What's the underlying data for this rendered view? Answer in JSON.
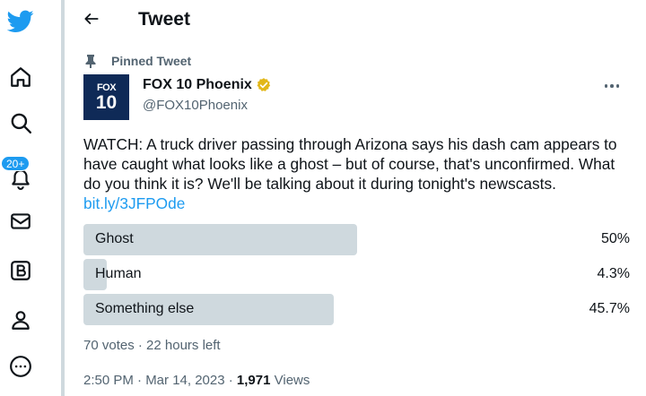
{
  "sidebar": {
    "items": [
      {
        "icon": "twitter-logo-icon"
      },
      {
        "icon": "home-icon"
      },
      {
        "icon": "search-icon"
      },
      {
        "icon": "notifications-icon"
      },
      {
        "icon": "messages-icon"
      },
      {
        "icon": "bookmarks-icon"
      },
      {
        "icon": "profile-icon"
      },
      {
        "icon": "more-icon"
      }
    ],
    "notification_count": "20+"
  },
  "header": {
    "title": "Tweet"
  },
  "tweet": {
    "pinned_label": "Pinned Tweet",
    "avatar": {
      "line1": "FOX",
      "line2": "10"
    },
    "display_name": "FOX 10 Phoenix",
    "handle": "@FOX10Phoenix",
    "text": "WATCH: A truck driver passing through Arizona says his dash cam appears to have caught what looks like a ghost – but of course, that's unconfirmed. What do you think it is? We'll be talking about it during tonight's newscasts. ",
    "link": "bit.ly/3JFPOde",
    "poll": {
      "options": [
        {
          "label": "Ghost",
          "percent_text": "50%",
          "percent": 50
        },
        {
          "label": "Human",
          "percent_text": "4.3%",
          "percent": 4.3
        },
        {
          "label": "Something else",
          "percent_text": "45.7%",
          "percent": 45.7
        }
      ],
      "meta": "70 votes · 22 hours left"
    },
    "time": "2:50 PM · Mar 14, 2023 · ",
    "views_count": "1,971",
    "views_label": " Views"
  },
  "colors": {
    "accent": "#1d9bf0",
    "text_primary": "#0f1419",
    "text_secondary": "#536471",
    "poll_bar": "#cfd9de",
    "verified_gold": "#e2b719"
  }
}
